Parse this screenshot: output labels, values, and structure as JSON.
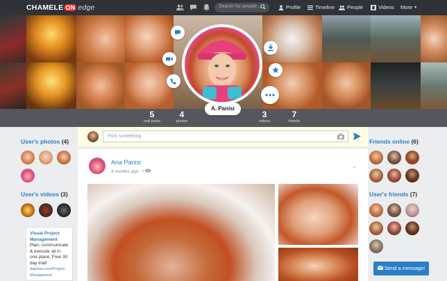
{
  "brand": {
    "name_left": "CHAMELE",
    "name_on": "ON",
    "name_right": "edge"
  },
  "search": {
    "placeholder": "Search for people..."
  },
  "nav": {
    "profile": "Profile",
    "timeline": "Timeline",
    "people": "People",
    "videos": "Videos",
    "more": "More"
  },
  "profile": {
    "name": "A. Panisi"
  },
  "stats": [
    {
      "value": "5",
      "label": "wall posts"
    },
    {
      "value": "4",
      "label": "photos"
    },
    {
      "value": "3",
      "label": "videos"
    },
    {
      "value": "7",
      "label": "friends"
    }
  ],
  "left": {
    "photos_title": "User's photos",
    "photos_count": "(4)",
    "videos_title": "User's videos",
    "videos_count": "(3)"
  },
  "ad": {
    "title": "Visual Project Management",
    "text": "Plan, communicate & execute all in one place. Free 30 day trial!",
    "url": "dapulse.com/Project-Management"
  },
  "composer": {
    "placeholder": "Post something"
  },
  "post": {
    "author": "Ana Panisi",
    "time": "4 months ago"
  },
  "right": {
    "online_title": "Friends online",
    "online_count": "(6)",
    "friends_title": "User's friends",
    "friends_count": "(7)",
    "send_label": "Send a message!"
  },
  "colors": {
    "accent": "#2a7ec8",
    "topbar": "#2f3238",
    "composer_bg": "#fffde3"
  }
}
